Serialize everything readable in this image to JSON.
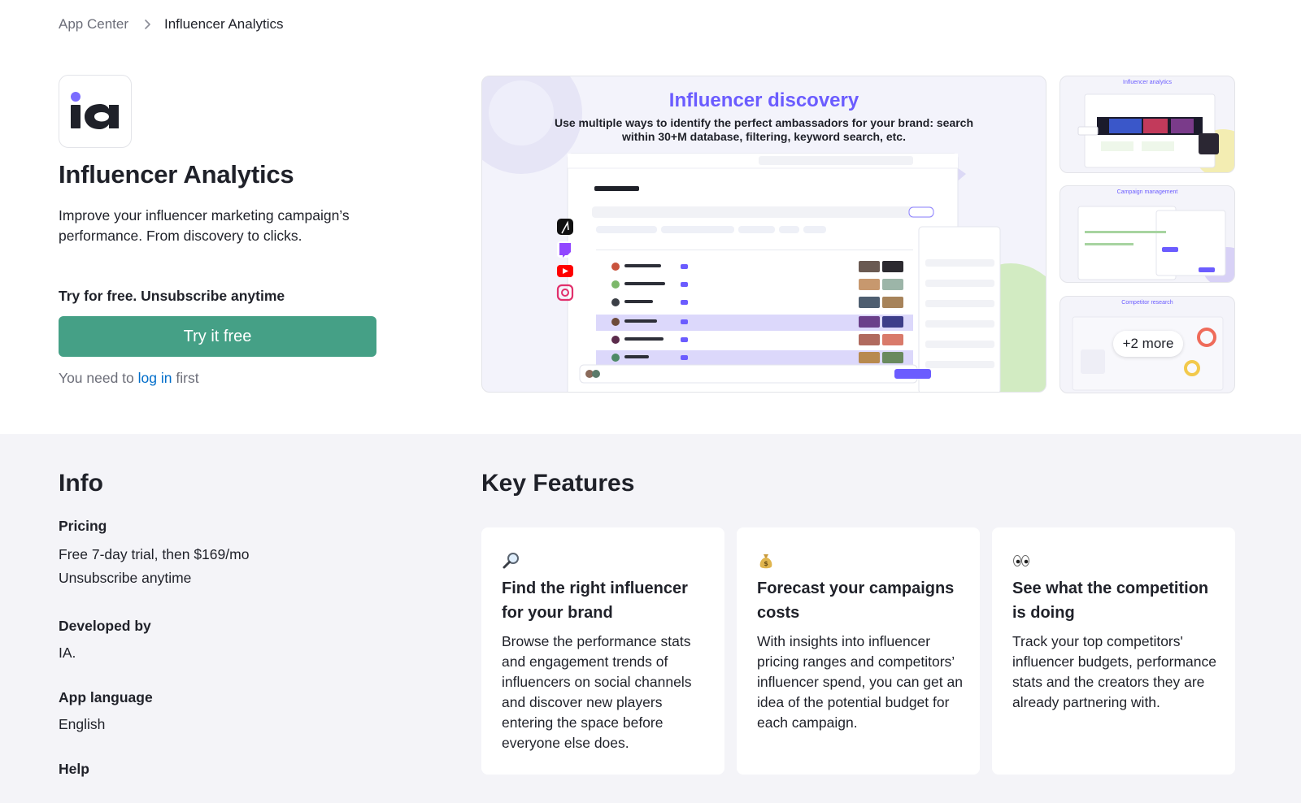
{
  "breadcrumb": {
    "parent": "App Center",
    "current": "Influencer Analytics"
  },
  "app": {
    "logo_text": "ia",
    "title": "Influencer Analytics",
    "description": "Improve your influencer marketing campaign’s performance. From discovery to clicks.",
    "trial_note": "Try for free. Unsubscribe anytime",
    "try_button": "Try it free",
    "login_prefix": "You need to ",
    "login_link": "log in",
    "login_suffix": " first"
  },
  "gallery": {
    "main": {
      "title": "Influencer discovery",
      "subtitle": "Use multiple ways to identify the perfect ambassadors for your brand: search within 30+M database, filtering, keyword search, etc."
    },
    "thumbs": [
      {
        "title": "Influencer analytics"
      },
      {
        "title": "Campaign management"
      },
      {
        "title": "Competitor research",
        "more_label": "+2 more"
      }
    ]
  },
  "info": {
    "heading": "Info",
    "pricing_label": "Pricing",
    "pricing_line1": "Free 7-day trial, then $169/mo",
    "pricing_line2": "Unsubscribe anytime",
    "developer_label": "Developed by",
    "developer_value": "IA.",
    "language_label": "App language",
    "language_value": "English",
    "help_label": "Help"
  },
  "key_features": {
    "heading": "Key Features",
    "cards": [
      {
        "icon": "magnifier-icon",
        "title": "Find the right influencer for your brand",
        "body": "Browse the performance stats and engagement trends of influencers on social channels and discover new players entering the space before everyone else does."
      },
      {
        "icon": "money-bag-icon",
        "title": "Forecast your campaigns costs",
        "body": "With insights into influencer pricing ranges and competitors’ influencer spend, you can get an idea of the potential budget for each campaign."
      },
      {
        "icon": "eyes-icon",
        "title": "See what the competition is doing",
        "body": "Track your top competitors' influencer budgets, performance stats and the creators they are already partnering with."
      }
    ]
  },
  "colors": {
    "accent_green": "#45a086",
    "link_blue": "#006dca",
    "brand_purple": "#6b5cff"
  }
}
